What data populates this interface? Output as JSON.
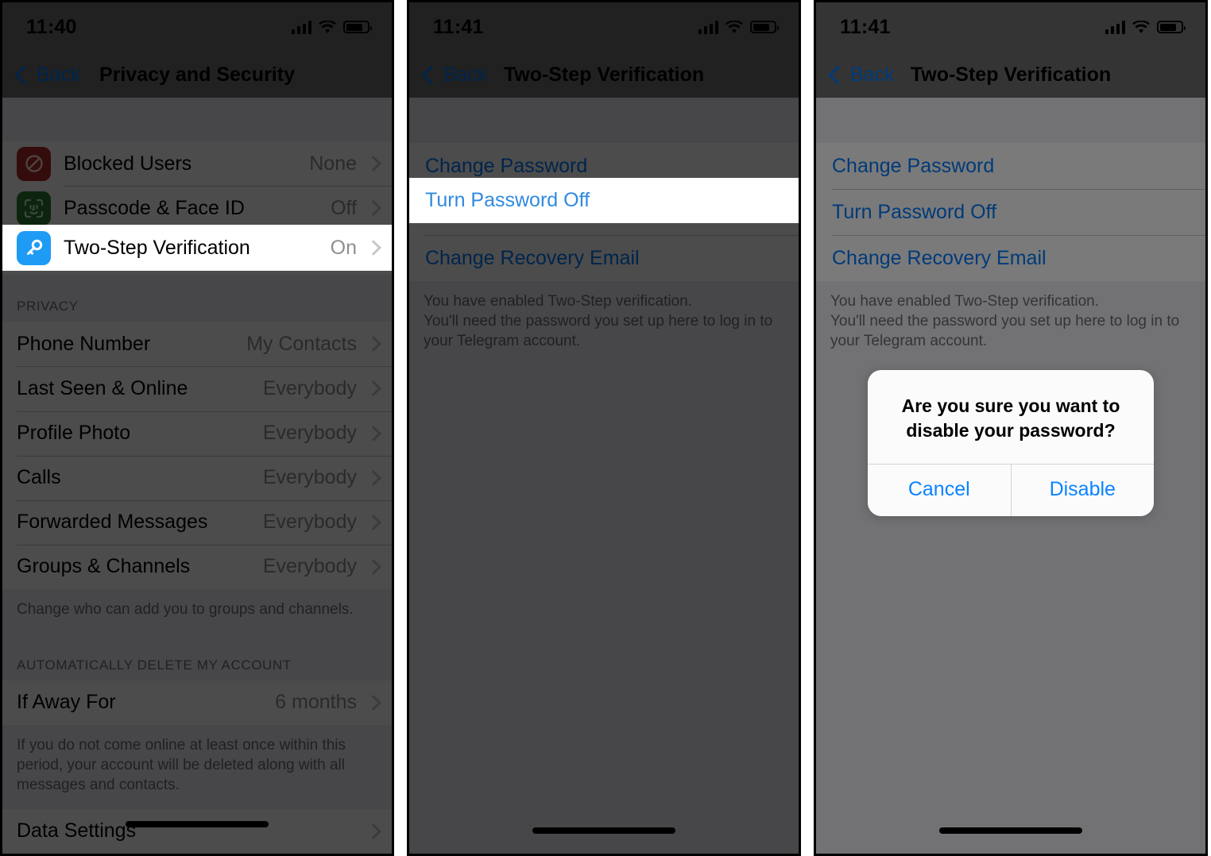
{
  "panels": [
    {
      "status": {
        "time": "11:40",
        "signal_icon": "cellular-bars-icon",
        "wifi_icon": "wifi-icon",
        "battery_icon": "battery-icon"
      },
      "nav": {
        "back_label": "Back",
        "title": "Privacy and Security"
      },
      "security_rows": [
        {
          "icon": "block-icon",
          "label": "Blocked Users",
          "value": "None"
        },
        {
          "icon": "face-id-icon",
          "label": "Passcode & Face ID",
          "value": "Off"
        }
      ],
      "highlight_row": {
        "icon": "key-icon",
        "label": "Two-Step Verification",
        "value": "On"
      },
      "privacy_header": "PRIVACY",
      "privacy_rows": [
        {
          "label": "Phone Number",
          "value": "My Contacts"
        },
        {
          "label": "Last Seen & Online",
          "value": "Everybody"
        },
        {
          "label": "Profile Photo",
          "value": "Everybody"
        },
        {
          "label": "Calls",
          "value": "Everybody"
        },
        {
          "label": "Forwarded Messages",
          "value": "Everybody"
        },
        {
          "label": "Groups & Channels",
          "value": "Everybody"
        }
      ],
      "privacy_footnote": "Change who can add you to groups and channels.",
      "delete_header": "AUTOMATICALLY DELETE MY ACCOUNT",
      "delete_rows": [
        {
          "label": "If Away For",
          "value": "6 months"
        }
      ],
      "delete_footnote": "If you do not come online at least once within this period, your account will be deleted along with all messages and contacts.",
      "last_row": {
        "label": "Data Settings",
        "value": ""
      }
    },
    {
      "status": {
        "time": "11:41"
      },
      "nav": {
        "back_label": "Back",
        "title": "Two-Step Verification"
      },
      "links_before": [
        "Change Password"
      ],
      "highlight_link": "Turn Password Off",
      "links_after": [
        "Change Recovery Email"
      ],
      "footnote": "You have enabled Two-Step verification.\nYou'll need the password you set up here to log in to your Telegram account."
    },
    {
      "status": {
        "time": "11:41"
      },
      "nav": {
        "back_label": "Back",
        "title": "Two-Step Verification"
      },
      "links": [
        "Change Password",
        "Turn Password Off",
        "Change Recovery Email"
      ],
      "footnote": "You have enabled Two-Step verification.\nYou'll need the password you set up here to log in to your Telegram account.",
      "alert": {
        "message": "Are you sure you want to disable your password?",
        "cancel_label": "Cancel",
        "confirm_label": "Disable"
      }
    }
  ],
  "colors": {
    "accent_blue": "#007aff",
    "alert_blue": "#0a84ff",
    "row_bg": "#ffffff",
    "group_bg": "#efeff4",
    "separator": "#c8c7cc",
    "value_gray": "#8e8e93",
    "icon_blocked": "#b02b2b",
    "icon_faceid": "#2e7d32",
    "icon_key": "#1e9bf5"
  }
}
